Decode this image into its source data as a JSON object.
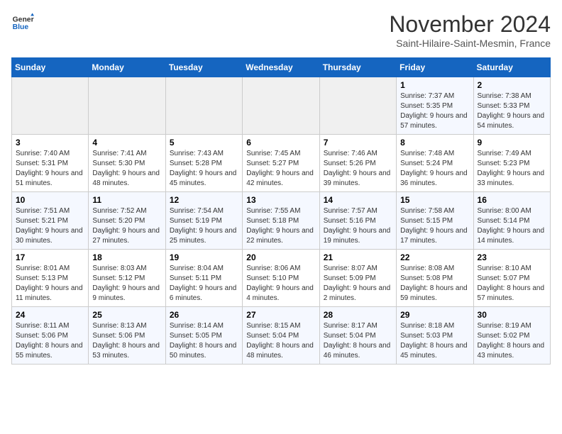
{
  "header": {
    "logo_line1": "General",
    "logo_line2": "Blue",
    "month": "November 2024",
    "location": "Saint-Hilaire-Saint-Mesmin, France"
  },
  "days_of_week": [
    "Sunday",
    "Monday",
    "Tuesday",
    "Wednesday",
    "Thursday",
    "Friday",
    "Saturday"
  ],
  "weeks": [
    [
      {
        "day": "",
        "info": ""
      },
      {
        "day": "",
        "info": ""
      },
      {
        "day": "",
        "info": ""
      },
      {
        "day": "",
        "info": ""
      },
      {
        "day": "",
        "info": ""
      },
      {
        "day": "1",
        "info": "Sunrise: 7:37 AM\nSunset: 5:35 PM\nDaylight: 9 hours and 57 minutes."
      },
      {
        "day": "2",
        "info": "Sunrise: 7:38 AM\nSunset: 5:33 PM\nDaylight: 9 hours and 54 minutes."
      }
    ],
    [
      {
        "day": "3",
        "info": "Sunrise: 7:40 AM\nSunset: 5:31 PM\nDaylight: 9 hours and 51 minutes."
      },
      {
        "day": "4",
        "info": "Sunrise: 7:41 AM\nSunset: 5:30 PM\nDaylight: 9 hours and 48 minutes."
      },
      {
        "day": "5",
        "info": "Sunrise: 7:43 AM\nSunset: 5:28 PM\nDaylight: 9 hours and 45 minutes."
      },
      {
        "day": "6",
        "info": "Sunrise: 7:45 AM\nSunset: 5:27 PM\nDaylight: 9 hours and 42 minutes."
      },
      {
        "day": "7",
        "info": "Sunrise: 7:46 AM\nSunset: 5:26 PM\nDaylight: 9 hours and 39 minutes."
      },
      {
        "day": "8",
        "info": "Sunrise: 7:48 AM\nSunset: 5:24 PM\nDaylight: 9 hours and 36 minutes."
      },
      {
        "day": "9",
        "info": "Sunrise: 7:49 AM\nSunset: 5:23 PM\nDaylight: 9 hours and 33 minutes."
      }
    ],
    [
      {
        "day": "10",
        "info": "Sunrise: 7:51 AM\nSunset: 5:21 PM\nDaylight: 9 hours and 30 minutes."
      },
      {
        "day": "11",
        "info": "Sunrise: 7:52 AM\nSunset: 5:20 PM\nDaylight: 9 hours and 27 minutes."
      },
      {
        "day": "12",
        "info": "Sunrise: 7:54 AM\nSunset: 5:19 PM\nDaylight: 9 hours and 25 minutes."
      },
      {
        "day": "13",
        "info": "Sunrise: 7:55 AM\nSunset: 5:18 PM\nDaylight: 9 hours and 22 minutes."
      },
      {
        "day": "14",
        "info": "Sunrise: 7:57 AM\nSunset: 5:16 PM\nDaylight: 9 hours and 19 minutes."
      },
      {
        "day": "15",
        "info": "Sunrise: 7:58 AM\nSunset: 5:15 PM\nDaylight: 9 hours and 17 minutes."
      },
      {
        "day": "16",
        "info": "Sunrise: 8:00 AM\nSunset: 5:14 PM\nDaylight: 9 hours and 14 minutes."
      }
    ],
    [
      {
        "day": "17",
        "info": "Sunrise: 8:01 AM\nSunset: 5:13 PM\nDaylight: 9 hours and 11 minutes."
      },
      {
        "day": "18",
        "info": "Sunrise: 8:03 AM\nSunset: 5:12 PM\nDaylight: 9 hours and 9 minutes."
      },
      {
        "day": "19",
        "info": "Sunrise: 8:04 AM\nSunset: 5:11 PM\nDaylight: 9 hours and 6 minutes."
      },
      {
        "day": "20",
        "info": "Sunrise: 8:06 AM\nSunset: 5:10 PM\nDaylight: 9 hours and 4 minutes."
      },
      {
        "day": "21",
        "info": "Sunrise: 8:07 AM\nSunset: 5:09 PM\nDaylight: 9 hours and 2 minutes."
      },
      {
        "day": "22",
        "info": "Sunrise: 8:08 AM\nSunset: 5:08 PM\nDaylight: 8 hours and 59 minutes."
      },
      {
        "day": "23",
        "info": "Sunrise: 8:10 AM\nSunset: 5:07 PM\nDaylight: 8 hours and 57 minutes."
      }
    ],
    [
      {
        "day": "24",
        "info": "Sunrise: 8:11 AM\nSunset: 5:06 PM\nDaylight: 8 hours and 55 minutes."
      },
      {
        "day": "25",
        "info": "Sunrise: 8:13 AM\nSunset: 5:06 PM\nDaylight: 8 hours and 53 minutes."
      },
      {
        "day": "26",
        "info": "Sunrise: 8:14 AM\nSunset: 5:05 PM\nDaylight: 8 hours and 50 minutes."
      },
      {
        "day": "27",
        "info": "Sunrise: 8:15 AM\nSunset: 5:04 PM\nDaylight: 8 hours and 48 minutes."
      },
      {
        "day": "28",
        "info": "Sunrise: 8:17 AM\nSunset: 5:04 PM\nDaylight: 8 hours and 46 minutes."
      },
      {
        "day": "29",
        "info": "Sunrise: 8:18 AM\nSunset: 5:03 PM\nDaylight: 8 hours and 45 minutes."
      },
      {
        "day": "30",
        "info": "Sunrise: 8:19 AM\nSunset: 5:02 PM\nDaylight: 8 hours and 43 minutes."
      }
    ]
  ]
}
